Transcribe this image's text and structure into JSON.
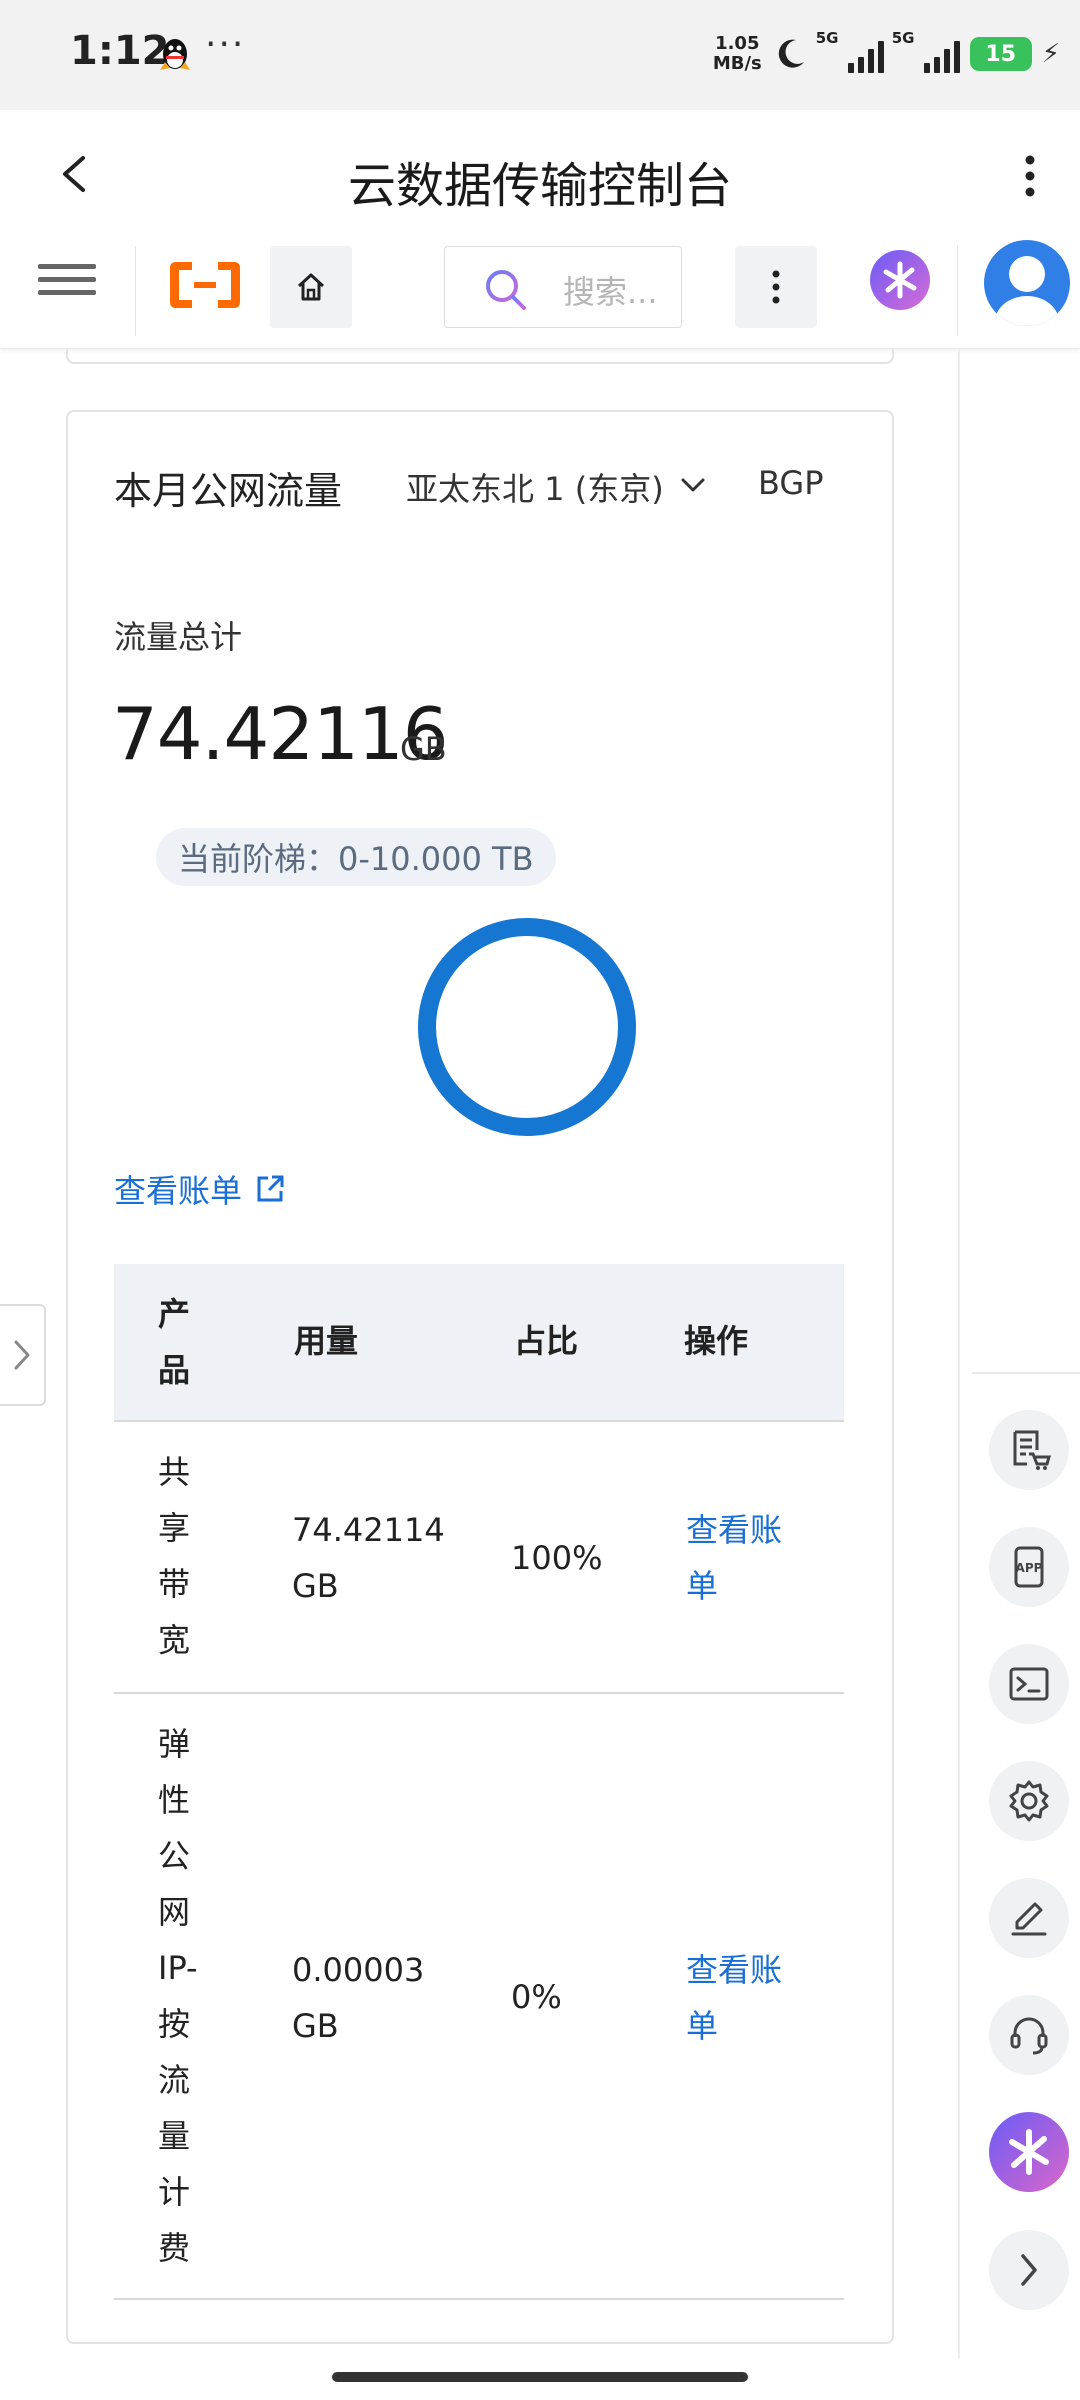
{
  "status_bar": {
    "time": "1:12",
    "more": "···",
    "net_speed_value": "1.05",
    "net_speed_unit": "MB/s",
    "sim1": "5G",
    "sim2": "5G",
    "battery": "15"
  },
  "titlebar": {
    "title": "云数据传输控制台"
  },
  "toolbar": {
    "search_placeholder": "搜索..."
  },
  "card": {
    "title": "本月公网流量",
    "region": "亚太东北 1 (东京)",
    "line_type": "BGP",
    "total_label": "流量总计",
    "total_value": "74.42116",
    "total_unit": "GB",
    "tier_label": "当前阶梯：0-10.000 TB",
    "ring_progress": 1.0,
    "ring_color": "#1677d2",
    "view_bill_label": "查看账单"
  },
  "table": {
    "headers": {
      "product": "产品",
      "usage": "用量",
      "share": "占比",
      "action": "操作"
    },
    "rows": [
      {
        "product": "共享带宽",
        "usage_value": "74.42114",
        "usage_unit": "GB",
        "share": "100%",
        "action": "查看账单"
      },
      {
        "product": "弹性公网IP-按流量计费",
        "usage_value": "0.00003",
        "usage_unit": "GB",
        "share": "0%",
        "action": "查看账单"
      }
    ]
  },
  "colors": {
    "accent": "#1a6fd6",
    "brand": "#ff6a00"
  }
}
